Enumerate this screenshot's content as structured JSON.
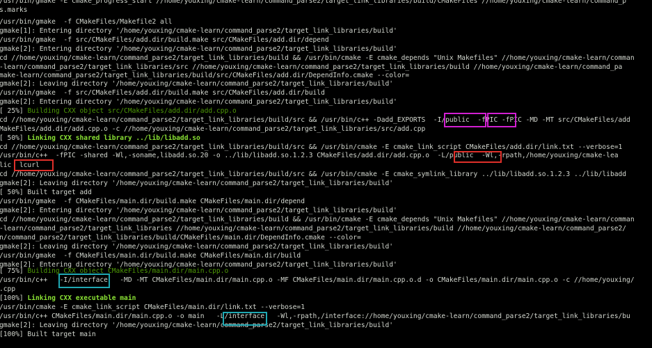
{
  "terminal": {
    "lines": [
      {
        "text": "/usr/bin/gmake -E cmake_progress_start //home/youxing/cmake-learn/command_parse2/target_link_libraries/build/CMakeFiles //home/youxing/cmake-learn/command_p",
        "style": "normal"
      },
      {
        "text": "s.marks",
        "style": "normal"
      },
      {
        "text": "/usr/bin/gmake  -f CMakeFiles/Makefile2 all",
        "style": "normal"
      },
      {
        "text": "gmake[1]: Entering directory '/home/youxing/cmake-learn/command_parse2/target_link_libraries/build'",
        "style": "normal"
      },
      {
        "text": "/usr/bin/gmake  -f src/CMakeFiles/add.dir/build.make src/CMakeFiles/add.dir/depend",
        "style": "normal"
      },
      {
        "text": "gmake[2]: Entering directory '/home/youxing/cmake-learn/command_parse2/target_link_libraries/build'",
        "style": "normal"
      },
      {
        "text": "cd //home/youxing/cmake-learn/command_parse2/target_link_libraries/build && /usr/bin/cmake -E cmake_depends \"Unix Makefiles\" //home/youxing/cmake-learn/comman",
        "style": "normal"
      },
      {
        "text": "-learn/command_parse2/target_link_libraries/src //home/youxing/cmake-learn/command_parse2/target_link_libraries/build //home/youxing/cmake-learn/command_pa",
        "style": "normal"
      },
      {
        "text": "make-learn/command_parse2/target_link_libraries/build/src/CMakeFiles/add.dir/DependInfo.cmake --color=",
        "style": "normal"
      },
      {
        "text": "gmake[2]: Leaving directory '/home/youxing/cmake-learn/command_parse2/target_link_libraries/build'",
        "style": "normal"
      },
      {
        "text": "/usr/bin/gmake  -f src/CMakeFiles/add.dir/build.make src/CMakeFiles/add.dir/build",
        "style": "normal"
      },
      {
        "text": "gmake[2]: Entering directory '/home/youxing/cmake-learn/command_parse2/target_link_libraries/build'",
        "style": "normal"
      },
      {
        "text": "Building CXX object src/CMakeFiles/add.dir/add.cpp.o",
        "prefix": "[ 25%] ",
        "style": "green"
      },
      {
        "text": "cd //home/youxing/cmake-learn/command_parse2/target_link_libraries/build/src && /usr/bin/c++ -Dadd_EXPORTS  -I/public  -fPIC -fPIC -MD -MT src/CMakeFiles/add",
        "style": "normal"
      },
      {
        "text": "MakeFiles/add.dir/add.cpp.o -c //home/youxing/cmake-learn/command_parse2/target_link_libraries/src/add.cpp",
        "style": "normal"
      },
      {
        "text": "Linking CXX shared library ../lib/libadd.so",
        "prefix": "[ 50%] ",
        "style": "bold-green"
      },
      {
        "text": "cd //home/youxing/cmake-learn/command_parse2/target_link_libraries/build/src && /usr/bin/cmake -E cmake_link_script CMakeFiles/add.dir/link.txt --verbose=1",
        "style": "normal"
      },
      {
        "text": "/usr/bin/c++  -fPIC -shared -Wl,-soname,libadd.so.20 -o ../lib/libadd.so.1.2.3 CMakeFiles/add.dir/add.cpp.o  -L/public  -Wl,-rpath,/home/youxing/cmake-lea",
        "style": "normal"
      },
      {
        "text": "lic  lcurl",
        "style": "normal"
      },
      {
        "text": "cd //home/youxing/cmake-learn/command_parse2/target_link_libraries/build/src && /usr/bin/cmake -E cmake_symlink_library ../lib/libadd.so.1.2.3 ../lib/libadd",
        "style": "normal"
      },
      {
        "text": "gmake[2]: Leaving directory '/home/youxing/cmake-learn/command_parse2/target_link_libraries/build'",
        "style": "normal"
      },
      {
        "text": "[ 50%] Built target add",
        "style": "normal"
      },
      {
        "text": "/usr/bin/gmake  -f CMakeFiles/main.dir/build.make CMakeFiles/main.dir/depend",
        "style": "normal"
      },
      {
        "text": "gmake[2]: Entering directory '/home/youxing/cmake-learn/command_parse2/target_link_libraries/build'",
        "style": "normal"
      },
      {
        "text": "cd //home/youxing/cmake-learn/command_parse2/target_link_libraries/build && /usr/bin/cmake -E cmake_depends \"Unix Makefiles\" //home/youxing/cmake-learn/comman",
        "style": "normal"
      },
      {
        "text": "-learn/command_parse2/target_link_libraries //home/youxing/cmake-learn/command_parse2/target_link_libraries/build //home/youxing/cmake-learn/command_parse2/",
        "style": "normal"
      },
      {
        "text": "n/command_parse2/target_link_libraries/build/CMakeFiles/main.dir/DependInfo.cmake --color=",
        "style": "normal"
      },
      {
        "text": "gmake[2]: Leaving directory '/home/youxing/cmake-learn/command_parse2/target_link_libraries/build'",
        "style": "normal"
      },
      {
        "text": "/usr/bin/gmake  -f CMakeFiles/main.dir/build.make CMakeFiles/main.dir/build",
        "style": "normal"
      },
      {
        "text": "gmake[2]: Entering directory '/home/youxing/cmake-learn/command_parse2/target_link_libraries/build'",
        "style": "normal"
      },
      {
        "text": "Building CXX object CMakeFiles/main.dir/main.cpp.o",
        "prefix": "[ 75%] ",
        "style": "green"
      },
      {
        "text": "/usr/bin/c++   -I/interface   -MD -MT CMakeFiles/main.dir/main.cpp.o -MF CMakeFiles/main.dir/main.cpp.o.d -o CMakeFiles/main.dir/main.cpp.o -c //home/youxing/",
        "style": "normal"
      },
      {
        "text": ".cpp",
        "style": "normal"
      },
      {
        "text": "Linking CXX executable main",
        "prefix": "[100%] ",
        "style": "bold-green"
      },
      {
        "text": "/usr/bin/cmake -E cmake_link_script CMakeFiles/main.dir/link.txt --verbose=1",
        "style": "normal"
      },
      {
        "text": "/usr/bin/c++ CMakeFiles/main.dir/main.cpp.o -o main   -L/interface   -Wl,-rpath,/interface://home/youxing/cmake-learn/command_parse2/target_link_libraries/bu",
        "style": "normal"
      },
      {
        "text": "gmake[2]: Leaving directory '/home/youxing/cmake-learn/command_parse2/target_link_libraries/build'",
        "style": "normal"
      },
      {
        "text": "[100%] Built target main",
        "style": "normal"
      }
    ],
    "colors": {
      "background": "#000000",
      "text": "#d3d7cf",
      "green": "#4e9a06",
      "bold_green": "#8ae234",
      "highlight_magenta": "#d21fd2",
      "highlight_red": "#e0302a",
      "highlight_teal": "#1fa8b3"
    }
  },
  "annotations": [
    {
      "label": "-I/public",
      "color": "magenta"
    },
    {
      "label": "-fPIC",
      "color": "magenta"
    },
    {
      "label": "-L/public",
      "color": "red"
    },
    {
      "label": "lcurl",
      "color": "red"
    },
    {
      "label": "-I/interface",
      "color": "teal"
    },
    {
      "label": "-L/interface",
      "color": "teal"
    }
  ]
}
